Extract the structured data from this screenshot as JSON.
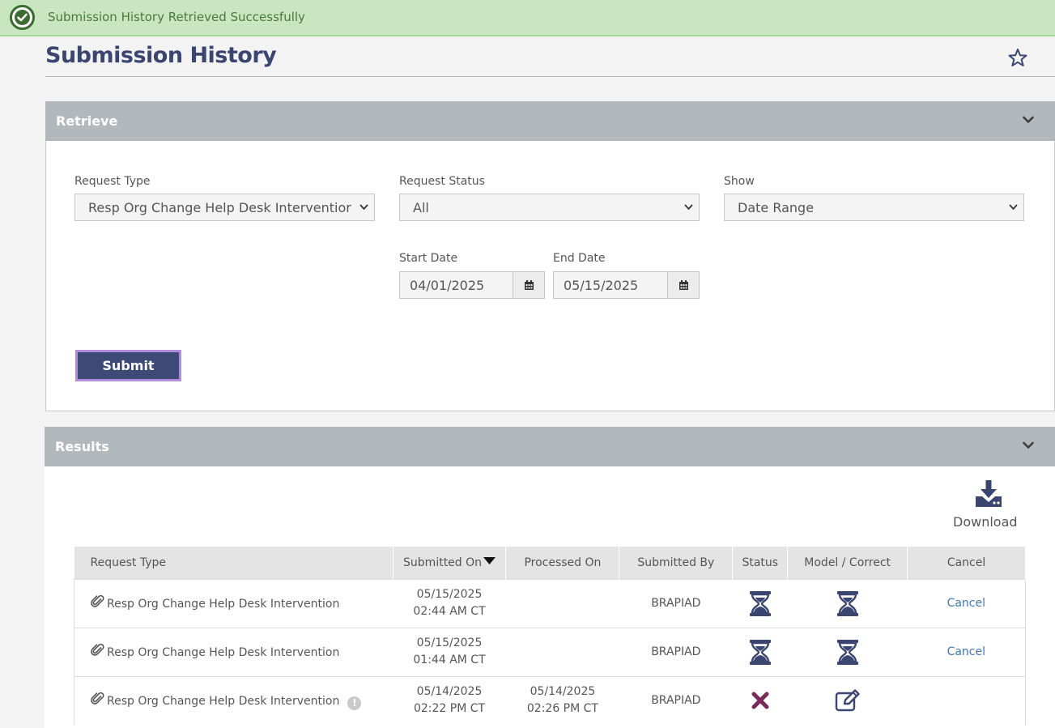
{
  "banner": {
    "message": "Submission History Retrieved Successfully",
    "icon": "check-circle-icon",
    "color": "#c8e6bf"
  },
  "page": {
    "title": "Submission History"
  },
  "retrieve": {
    "header": "Retrieve",
    "request_type": {
      "label": "Request Type",
      "value": "Resp Org Change Help Desk Interventior"
    },
    "request_status": {
      "label": "Request Status",
      "value": "All"
    },
    "show": {
      "label": "Show",
      "value": "Date Range"
    },
    "start_date": {
      "label": "Start Date",
      "value": "04/01/2025"
    },
    "end_date": {
      "label": "End Date",
      "value": "05/15/2025"
    },
    "submit_label": "Submit"
  },
  "results": {
    "header": "Results",
    "download_label": "Download",
    "columns": [
      "Request Type",
      "Submitted On",
      "Processed On",
      "Submitted By",
      "Status",
      "Model / Correct",
      "Cancel"
    ],
    "rows": [
      {
        "request_type": "Resp Org Change Help Desk Intervention",
        "submitted_date": "05/15/2025",
        "submitted_time": "02:44 AM CT",
        "processed_date": "",
        "processed_time": "",
        "submitted_by": "BRAPIAD",
        "status_icon": "hourglass-icon",
        "model_icon": "hourglass-icon",
        "cancel": "Cancel"
      },
      {
        "request_type": "Resp Org Change Help Desk Intervention",
        "submitted_date": "05/15/2025",
        "submitted_time": "01:44 AM CT",
        "processed_date": "",
        "processed_time": "",
        "submitted_by": "BRAPIAD",
        "status_icon": "hourglass-icon",
        "model_icon": "hourglass-icon",
        "cancel": "Cancel"
      },
      {
        "request_type": "Resp Org Change Help Desk Intervention",
        "warning_mark": "!",
        "submitted_date": "05/14/2025",
        "submitted_time": "02:22 PM CT",
        "processed_date": "05/14/2025",
        "processed_time": "02:26 PM CT",
        "submitted_by": "BRAPIAD",
        "status_icon": "x-icon",
        "model_icon": "edit-icon",
        "cancel": ""
      }
    ]
  },
  "colors": {
    "primary": "#3d4a76",
    "panel_header": "#b3b8bc",
    "link": "#3e78b8",
    "error": "#7a2a5a",
    "submit_border": "#b28ddd"
  }
}
